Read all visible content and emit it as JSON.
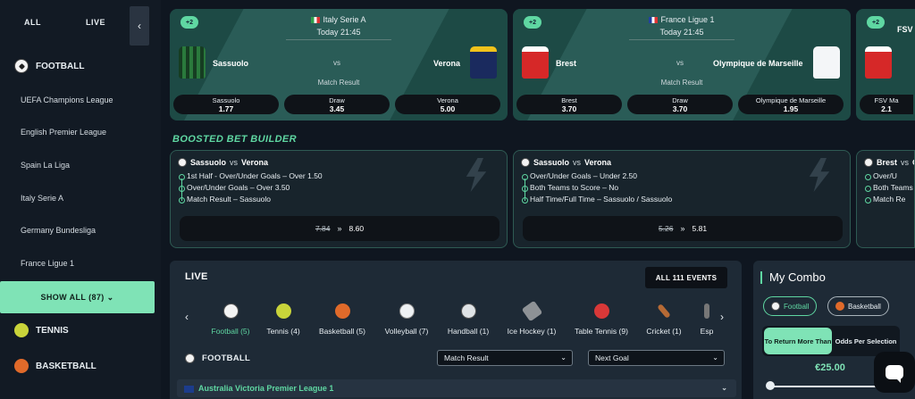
{
  "sidebar": {
    "tab_all": "ALL",
    "tab_live": "LIVE",
    "categories": {
      "football": "FOOTBALL",
      "tennis": "TENNIS",
      "basketball": "BASKETBALL"
    },
    "leagues": [
      "UEFA Champions League",
      "English Premier League",
      "Spain La Liga",
      "Italy Serie A",
      "Germany Bundesliga",
      "France Ligue 1"
    ],
    "show_all": "SHOW ALL (87) ⌄"
  },
  "matches": [
    {
      "league": "Italy Serie A",
      "time": "Today 21:45",
      "home": "Sassuolo",
      "away": "Verona",
      "vs": "vs",
      "market": "Match Result",
      "odds": [
        {
          "label": "Sassuolo",
          "value": "1.77"
        },
        {
          "label": "Draw",
          "value": "3.45"
        },
        {
          "label": "Verona",
          "value": "5.00"
        }
      ]
    },
    {
      "league": "France Ligue 1",
      "time": "Today 21:45",
      "home": "Brest",
      "away": "Olympique de Marseille",
      "vs": "vs",
      "market": "Match Result",
      "odds": [
        {
          "label": "Brest",
          "value": "3.70"
        },
        {
          "label": "Draw",
          "value": "3.70"
        },
        {
          "label": "Olympique de Marseille",
          "value": "1.95"
        }
      ]
    },
    {
      "league": "FSV",
      "odds": [
        {
          "label": "FSV Ma",
          "value": "2.1"
        }
      ]
    }
  ],
  "boost_badge": "+2",
  "boosted": {
    "title": "BOOSTED BET BUILDER",
    "cards": [
      {
        "home": "Sassuolo",
        "vs": "vs",
        "away": "Verona",
        "legs": [
          "1st Half - Over/Under Goals – Over 1.50",
          "Over/Under Goals – Over 3.50",
          "Match Result – Sassuolo"
        ],
        "old_odds": "7.84",
        "arrows": "»",
        "new_odds": "8.60"
      },
      {
        "home": "Sassuolo",
        "vs": "vs",
        "away": "Verona",
        "legs": [
          "Over/Under Goals – Under 2.50",
          "Both Teams to Score – No",
          "Half Time/Full Time – Sassuolo / Sassuolo"
        ],
        "old_odds": "5.26",
        "arrows": "»",
        "new_odds": "5.81"
      },
      {
        "home": "Brest",
        "vs": "vs",
        "away": "O",
        "legs": [
          "Over/U",
          "Both Teams",
          "Match Re"
        ]
      }
    ]
  },
  "live": {
    "title": "LIVE",
    "all_events": "ALL 111 EVENTS",
    "sports": [
      {
        "label": "Football (5)",
        "icon": "football-icon"
      },
      {
        "label": "Tennis (4)",
        "icon": "tennis-icon"
      },
      {
        "label": "Basketball (5)",
        "icon": "basketball-icon"
      },
      {
        "label": "Volleyball (7)",
        "icon": "volleyball-icon"
      },
      {
        "label": "Handball (1)",
        "icon": "handball-icon"
      },
      {
        "label": "Ice Hockey (1)",
        "icon": "ice-hockey-icon"
      },
      {
        "label": "Table Tennis (9)",
        "icon": "table-tennis-icon"
      },
      {
        "label": "Cricket (1)",
        "icon": "cricket-icon"
      },
      {
        "label": "Esp",
        "icon": "esports-icon"
      }
    ],
    "section": "FOOTBALL",
    "market_select": "Match Result",
    "goal_select": "Next Goal",
    "league_row": "Australia Victoria Premier League 1"
  },
  "combo": {
    "title": "My Combo",
    "chips": [
      "Football",
      "Basketball"
    ],
    "toggle_on": "To Return More Than",
    "toggle_off": "Odds Per Selection",
    "amount": "€25.00"
  },
  "colors": {
    "accent": "#5fd7a2",
    "card_bg": "#1d4a45",
    "page_bg": "#0f1620"
  }
}
